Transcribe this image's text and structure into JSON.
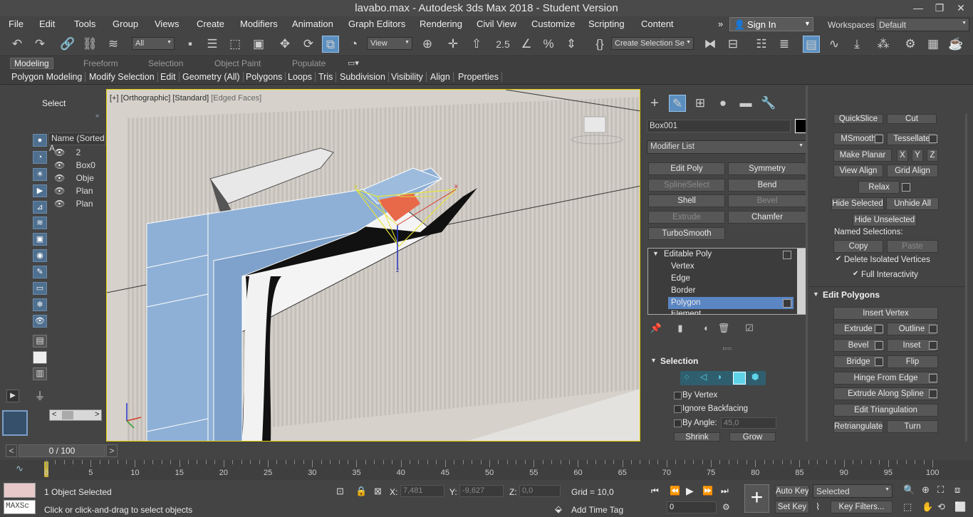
{
  "window": {
    "title": "lavabo.max - Autodesk 3ds Max 2018 - Student Version",
    "minimize": "—",
    "restore": "❐",
    "close": "✕"
  },
  "menu": [
    "File",
    "Edit",
    "Tools",
    "Group",
    "Views",
    "Create",
    "Modifiers",
    "Animation",
    "Graph Editors",
    "Rendering",
    "Civil View",
    "Customize",
    "Scripting",
    "Content"
  ],
  "menu_more": "»",
  "signin": "Sign In",
  "workspaces_label": "Workspaces:",
  "workspaces_value": "Default",
  "toolbar": {
    "filter": "All",
    "refcoord": "View",
    "selection_set": "Create Selection Se",
    "snap_label": "2.5"
  },
  "ribbon_tabs": [
    "Modeling",
    "Freeform",
    "Selection",
    "Object Paint",
    "Populate"
  ],
  "ribbon_sub": [
    "Polygon Modeling",
    "Modify Selection",
    "Edit",
    "Geometry (All)",
    "Polygons",
    "Loops",
    "Tris",
    "Subdivision",
    "Visibility",
    "Align",
    "Properties"
  ],
  "scene": {
    "select": "Select",
    "column": "Name (Sorted A",
    "items": [
      "2",
      "Box0",
      "Obje",
      "Plan",
      "Plan"
    ]
  },
  "viewport": {
    "label_plus": "[+]",
    "label_view": "[Orthographic]",
    "label_shading": "[Standard]",
    "label_edges": "[Edged Faces]"
  },
  "cmd": {
    "object_name": "Box001",
    "modifier_list": "Modifier List",
    "buttons": [
      {
        "label": "Edit Poly",
        "dim": false
      },
      {
        "label": "Symmetry",
        "dim": false
      },
      {
        "label": "SplineSelect",
        "dim": true
      },
      {
        "label": "Bend",
        "dim": false
      },
      {
        "label": "Shell",
        "dim": false
      },
      {
        "label": "Bevel",
        "dim": true
      },
      {
        "label": "Extrude",
        "dim": true
      },
      {
        "label": "Chamfer",
        "dim": false
      },
      {
        "label": "TurboSmooth",
        "dim": false
      }
    ],
    "stack": [
      "Editable Poly",
      "Vertex",
      "Edge",
      "Border",
      "Polygon",
      "Element"
    ],
    "selection_header": "Selection",
    "by_vertex": "By Vertex",
    "ignore_backfacing": "Ignore Backfacing",
    "by_angle": "By Angle:",
    "angle_value": "45,0",
    "shrink": "Shrink",
    "grow": "Grow"
  },
  "rollout": {
    "quickslice": "QuickSlice",
    "cut": "Cut",
    "msmooth": "MSmooth",
    "tessellate": "Tessellate",
    "make_planar": "Make Planar",
    "x": "X",
    "y": "Y",
    "z": "Z",
    "view_align": "View Align",
    "grid_align": "Grid Align",
    "relax": "Relax",
    "hide_selected": "Hide Selected",
    "unhide_all": "Unhide All",
    "hide_unselected": "Hide Unselected",
    "named_selections": "Named Selections:",
    "copy": "Copy",
    "paste": "Paste",
    "delete_isolated": "Delete Isolated Vertices",
    "full_interactivity": "Full Interactivity",
    "edit_polygons": "Edit Polygons",
    "insert_vertex": "Insert Vertex",
    "extrude": "Extrude",
    "outline": "Outline",
    "bevel": "Bevel",
    "inset": "Inset",
    "bridge": "Bridge",
    "flip": "Flip",
    "hinge": "Hinge From Edge",
    "extrude_spline": "Extrude Along Spline",
    "edit_triangulation": "Edit Triangulation",
    "retriangulate": "Retriangulate",
    "turn": "Turn"
  },
  "timeline": {
    "frame": "0 / 100",
    "prev": "<",
    "next": ">"
  },
  "ticks": [
    "0",
    "5",
    "10",
    "15",
    "20",
    "25",
    "30",
    "35",
    "40",
    "45",
    "50",
    "55",
    "60",
    "65",
    "70",
    "75",
    "80",
    "85",
    "90",
    "95",
    "100"
  ],
  "status": {
    "selected": "1 Object Selected",
    "prompt": "Click or click-and-drag to select objects",
    "x_label": "X:",
    "x": "7,481",
    "y_label": "Y:",
    "y": "-9,627",
    "z_label": "Z:",
    "z": "0,0",
    "grid": "Grid = 10,0",
    "add_time_tag": "Add Time Tag",
    "auto_key": "Auto Key",
    "set_key": "Set Key",
    "key_mode": "Selected",
    "key_filters": "Key Filters...",
    "frame_input": "0",
    "maxscript": "MAXSc"
  }
}
